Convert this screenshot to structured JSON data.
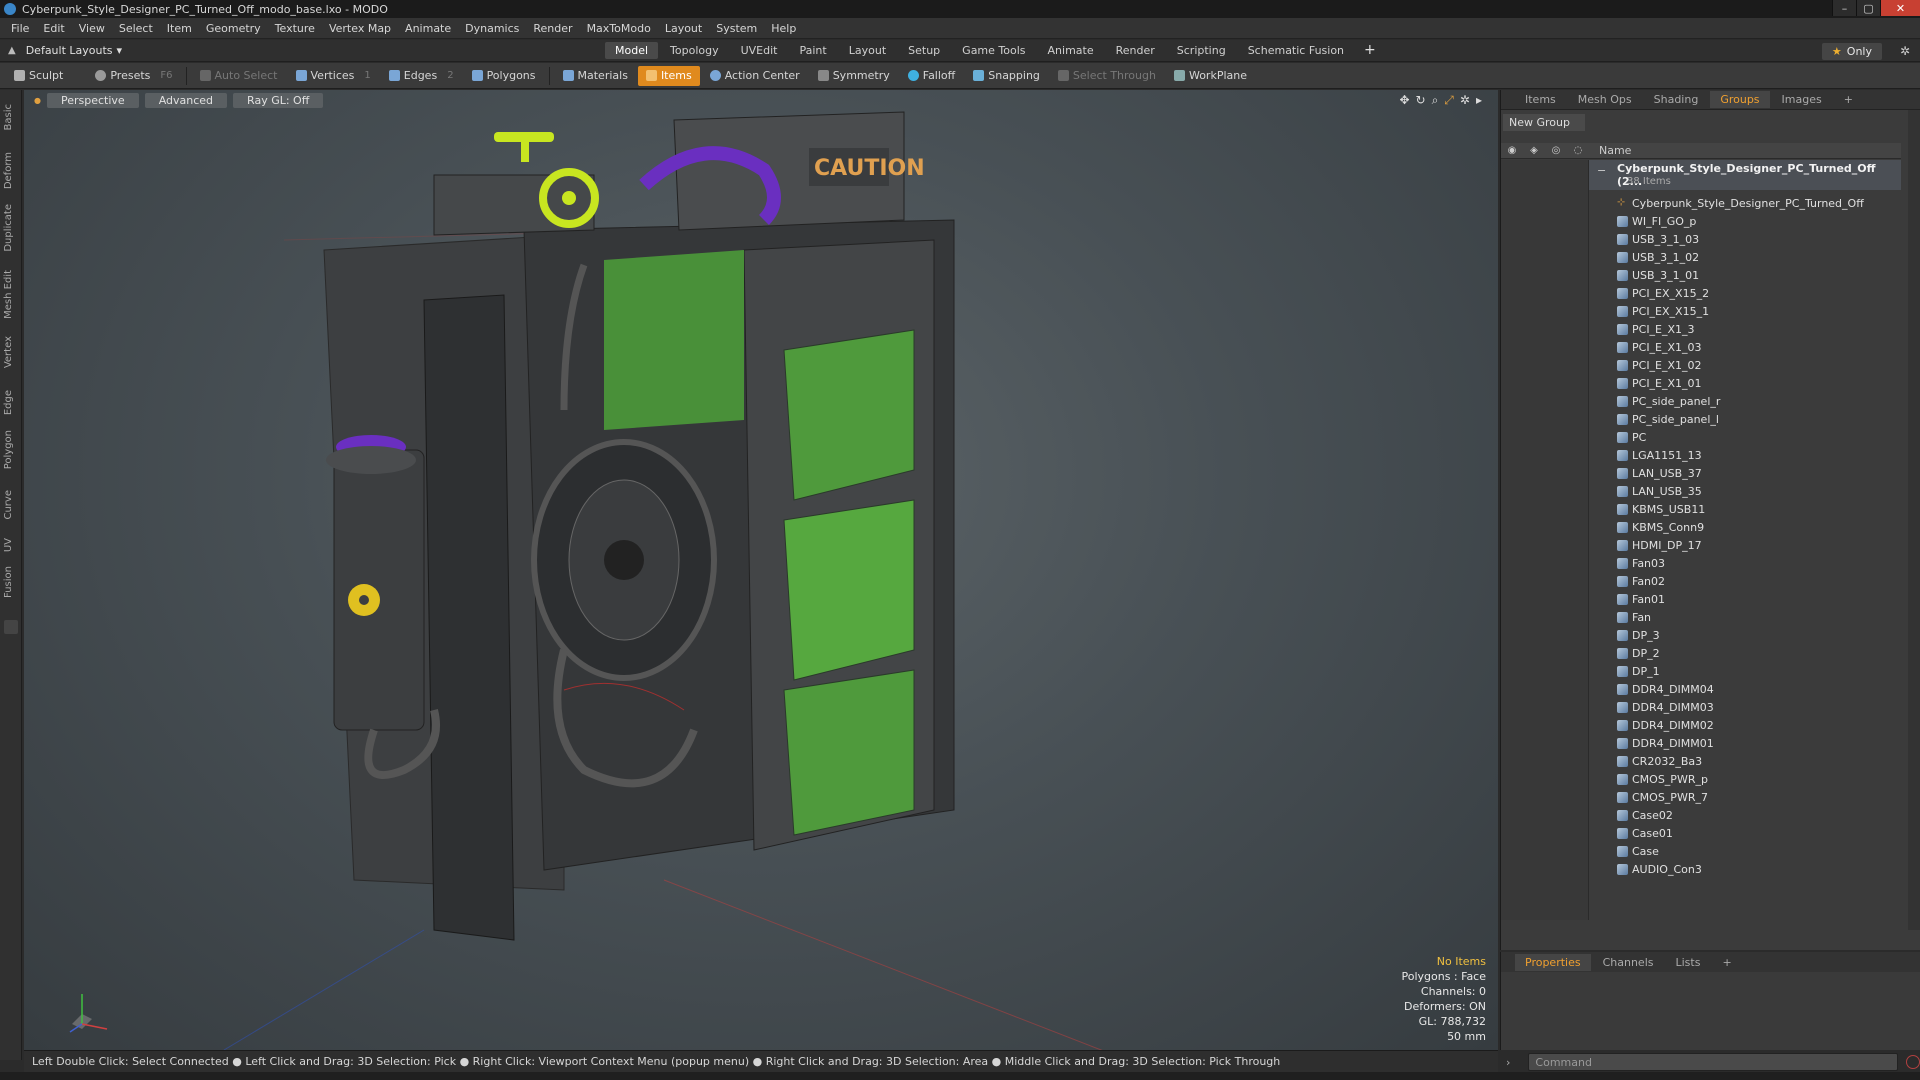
{
  "window": {
    "title": "Cyberpunk_Style_Designer_PC_Turned_Off_modo_base.lxo - MODO",
    "minimize": "–",
    "maximize": "▢",
    "close": "✕"
  },
  "menu": [
    "File",
    "Edit",
    "View",
    "Select",
    "Item",
    "Geometry",
    "Texture",
    "Vertex Map",
    "Animate",
    "Dynamics",
    "Render",
    "MaxToModo",
    "Layout",
    "System",
    "Help"
  ],
  "layout": {
    "selector": "Default Layouts",
    "tabs": [
      "Model",
      "Topology",
      "UVEdit",
      "Paint",
      "Layout",
      "Setup",
      "Game Tools",
      "Animate",
      "Render",
      "Scripting",
      "Schematic Fusion"
    ],
    "active_tab": "Model",
    "plus": "+",
    "only": "Only"
  },
  "toolbar": {
    "sculpt": "Sculpt",
    "presets": "Presets",
    "presets_hint": "F6",
    "auto_select": "Auto Select",
    "vertices": "Vertices",
    "vertices_hint": "1",
    "edges": "Edges",
    "edges_hint": "2",
    "polygons": "Polygons",
    "materials": "Materials",
    "items": "Items",
    "action_center": "Action Center",
    "symmetry": "Symmetry",
    "falloff": "Falloff",
    "snapping": "Snapping",
    "select_through": "Select Through",
    "workplane": "WorkPlane"
  },
  "left_tabs": [
    "Basic",
    "Deform",
    "Duplicate",
    "Mesh Edit",
    "Vertex",
    "Edge",
    "Polygon",
    "Curve",
    "UV",
    "Fusion"
  ],
  "viewport": {
    "perspective": "Perspective",
    "advanced": "Advanced",
    "raygl": "Ray GL: Off",
    "caution_text": "CAUTION",
    "info": {
      "no_items": "No Items",
      "polygons": "Polygons : Face",
      "channels": "Channels: 0",
      "deformers": "Deformers: ON",
      "gl": "GL: 788,732",
      "scale": "50 mm"
    }
  },
  "right_panel": {
    "tabs": [
      "Items",
      "Mesh Ops",
      "Shading",
      "Groups",
      "Images"
    ],
    "active_tab": "Groups",
    "new_group": "New Group",
    "name_header": "Name",
    "group_name": "Cyberpunk_Style_Designer_PC_Turned_Off (2...",
    "group_count": "38 Items",
    "items": [
      "Cyberpunk_Style_Designer_PC_Turned_Off",
      "WI_FI_GO_p",
      "USB_3_1_03",
      "USB_3_1_02",
      "USB_3_1_01",
      "PCI_EX_X15_2",
      "PCI_EX_X15_1",
      "PCI_E_X1_3",
      "PCI_E_X1_03",
      "PCI_E_X1_02",
      "PCI_E_X1_01",
      "PC_side_panel_r",
      "PC_side_panel_l",
      "PC",
      "LGA1151_13",
      "LAN_USB_37",
      "LAN_USB_35",
      "KBMS_USB11",
      "KBMS_Conn9",
      "HDMI_DP_17",
      "Fan03",
      "Fan02",
      "Fan01",
      "Fan",
      "DP_3",
      "DP_2",
      "DP_1",
      "DDR4_DIMM04",
      "DDR4_DIMM03",
      "DDR4_DIMM02",
      "DDR4_DIMM01",
      "CR2032_Ba3",
      "CMOS_PWR_p",
      "CMOS_PWR_7",
      "Case02",
      "Case01",
      "Case",
      "AUDIO_Con3"
    ]
  },
  "properties": {
    "tabs": [
      "Properties",
      "Channels",
      "Lists"
    ],
    "active_tab": "Properties",
    "plus": "+"
  },
  "status": "Left Double Click: Select Connected ● Left Click and Drag: 3D Selection: Pick ● Right Click: Viewport Context Menu (popup menu) ● Right Click and Drag: 3D Selection: Area ● Middle Click and Drag: 3D Selection: Pick Through",
  "command_placeholder": "Command",
  "colors": {
    "accent": "#e08a1e",
    "active_tab_text": "#f0a030",
    "caution": "#e0a050",
    "neon_green": "#5fc84a",
    "purple": "#6a2fc0",
    "yellow_valve": "#c8e620"
  }
}
